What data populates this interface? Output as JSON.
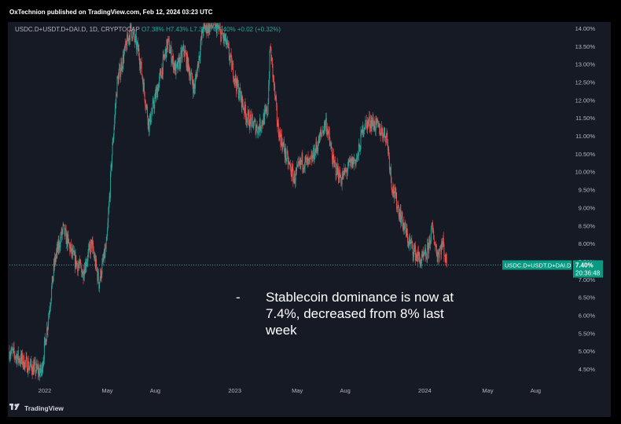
{
  "header": {
    "publisher_line": "OxTechnion published on TradingView.com, Feb 12, 2024 03:23 UTC"
  },
  "symbol": {
    "label": "USDC.D+USDT.D+DAI.D, 1D, CRYPTOCAP",
    "o": "O7.38%",
    "h": "H7.43%",
    "l": "L7.35%",
    "c": "C7.40%",
    "chg": "+0.02 (+0.32%)"
  },
  "footer": {
    "logo_text": "TradingView"
  },
  "caption": {
    "dash": "-",
    "text": "Stablecoin dominance is now at 7.4%, decreased from 8% last week"
  },
  "price_tag": {
    "symbol": "USDC.D+USDT.D+DAI.D",
    "value": "7.40%",
    "countdown": "20:36:48"
  },
  "colors": {
    "up": "#26a69a",
    "down": "#ef5350",
    "tag": "#089981",
    "bg": "#161a25"
  },
  "chart_data": {
    "type": "candlestick",
    "y_unit": "%",
    "ylim": [
      4.15,
      14.15
    ],
    "yticks": [
      "4.50%",
      "5.00%",
      "5.50%",
      "6.00%",
      "6.50%",
      "7.00%",
      "7.50%",
      "8.00%",
      "8.50%",
      "9.00%",
      "9.50%",
      "10.00%",
      "10.50%",
      "11.00%",
      "11.50%",
      "12.00%",
      "12.50%",
      "13.00%",
      "13.50%",
      "14.00%"
    ],
    "xticks": [
      "2022",
      "May",
      "Aug",
      "2023",
      "May",
      "Aug",
      "2024",
      "May",
      "Aug"
    ],
    "current_value": 7.4,
    "approx_daily_close_path": [
      {
        "date": "2021-10-25",
        "value": 5.0
      },
      {
        "date": "2021-12-01",
        "value": 4.6
      },
      {
        "date": "2021-12-25",
        "value": 4.4
      },
      {
        "date": "2022-01-05",
        "value": 5.6
      },
      {
        "date": "2022-01-20",
        "value": 7.5
      },
      {
        "date": "2022-02-05",
        "value": 8.4
      },
      {
        "date": "2022-02-25",
        "value": 7.6
      },
      {
        "date": "2022-03-15",
        "value": 7.2
      },
      {
        "date": "2022-04-01",
        "value": 8.0
      },
      {
        "date": "2022-04-15",
        "value": 6.9
      },
      {
        "date": "2022-04-30",
        "value": 8.0
      },
      {
        "date": "2022-05-10",
        "value": 10.5
      },
      {
        "date": "2022-05-20",
        "value": 12.5
      },
      {
        "date": "2022-06-15",
        "value": 14.0
      },
      {
        "date": "2022-07-01",
        "value": 13.3
      },
      {
        "date": "2022-07-20",
        "value": 11.3
      },
      {
        "date": "2022-08-10",
        "value": 12.6
      },
      {
        "date": "2022-08-25",
        "value": 13.6
      },
      {
        "date": "2022-09-10",
        "value": 12.8
      },
      {
        "date": "2022-09-25",
        "value": 13.4
      },
      {
        "date": "2022-10-15",
        "value": 12.3
      },
      {
        "date": "2022-11-01",
        "value": 14.0
      },
      {
        "date": "2022-11-25",
        "value": 14.1
      },
      {
        "date": "2022-12-15",
        "value": 13.6
      },
      {
        "date": "2023-01-05",
        "value": 12.4
      },
      {
        "date": "2023-01-25",
        "value": 11.5
      },
      {
        "date": "2023-02-15",
        "value": 11.2
      },
      {
        "date": "2023-03-05",
        "value": 11.7
      },
      {
        "date": "2023-03-10",
        "value": 13.5
      },
      {
        "date": "2023-03-25",
        "value": 11.2
      },
      {
        "date": "2023-04-10",
        "value": 10.4
      },
      {
        "date": "2023-04-25",
        "value": 9.8
      },
      {
        "date": "2023-05-10",
        "value": 10.3
      },
      {
        "date": "2023-05-25",
        "value": 10.2
      },
      {
        "date": "2023-06-10",
        "value": 10.8
      },
      {
        "date": "2023-06-25",
        "value": 11.4
      },
      {
        "date": "2023-07-10",
        "value": 10.2
      },
      {
        "date": "2023-07-25",
        "value": 9.8
      },
      {
        "date": "2023-08-10",
        "value": 10.2
      },
      {
        "date": "2023-08-25",
        "value": 10.4
      },
      {
        "date": "2023-09-05",
        "value": 11.3
      },
      {
        "date": "2023-09-20",
        "value": 11.4
      },
      {
        "date": "2023-10-05",
        "value": 11.2
      },
      {
        "date": "2023-10-20",
        "value": 11.0
      },
      {
        "date": "2023-10-30",
        "value": 9.6
      },
      {
        "date": "2023-11-15",
        "value": 8.8
      },
      {
        "date": "2023-11-30",
        "value": 8.1
      },
      {
        "date": "2023-12-15",
        "value": 7.7
      },
      {
        "date": "2023-12-25",
        "value": 7.5
      },
      {
        "date": "2024-01-05",
        "value": 7.7
      },
      {
        "date": "2024-01-15",
        "value": 8.4
      },
      {
        "date": "2024-01-25",
        "value": 7.7
      },
      {
        "date": "2024-02-05",
        "value": 8.0
      },
      {
        "date": "2024-02-12",
        "value": 7.4
      }
    ]
  }
}
